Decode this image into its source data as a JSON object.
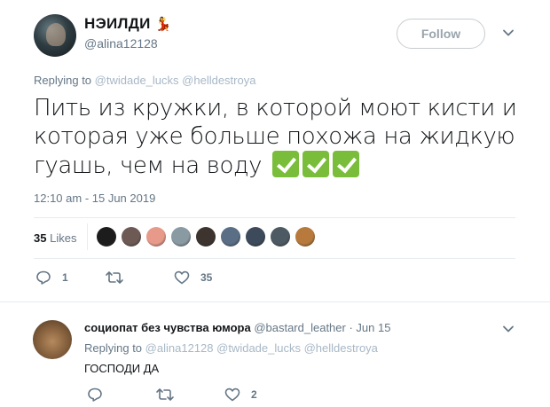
{
  "tweet": {
    "name": "НЭИЛДИ",
    "handle": "@alina12128",
    "follow_label": "Follow",
    "replying_prefix": "Replying to",
    "replying_to": [
      "@twidade_lucks",
      "@helldestroya"
    ],
    "text": "Пить из кружки, в которой моют кисти и которая уже больше похожа на жидкую гуашь, чем на воду",
    "emoji_count": 3,
    "timestamp": "12:10 am - 15 Jun 2019",
    "likes_count": "35",
    "likes_word": "Likes",
    "actions": {
      "reply_count": "1",
      "retweet_count": "",
      "like_count": "35"
    },
    "liker_colors": [
      "#1c1c1c",
      "#6e5a55",
      "#e79a8a",
      "#8a9aa3",
      "#3d3430",
      "#5a6f85",
      "#3c4a5c",
      "#4d5a64",
      "#b87a3c"
    ]
  },
  "reply": {
    "name": "социопат без чувства юмора",
    "handle": "@bastard_leather",
    "date": "· Jun 15",
    "replying_prefix": "Replying to",
    "replying_to": [
      "@alina12128",
      "@twidade_lucks",
      "@helldestroya"
    ],
    "text": "ГОСПОДИ ДА",
    "actions": {
      "reply_count": "",
      "retweet_count": "",
      "like_count": "2"
    }
  },
  "colors": {
    "text": "#14171a",
    "secondary": "#657786",
    "mention_faded": "#a8b8c6",
    "divider": "#e6ecf0",
    "check_green": "#7abd3a"
  }
}
